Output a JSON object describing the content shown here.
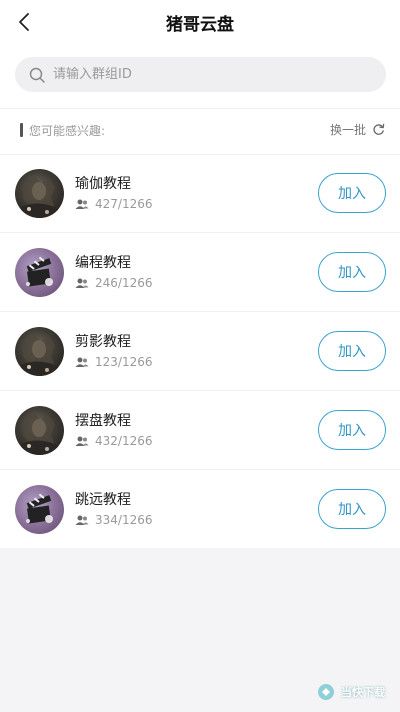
{
  "header": {
    "title": "猪哥云盘"
  },
  "search": {
    "placeholder": "请输入群组ID"
  },
  "section": {
    "title": "您可能感兴趣:",
    "refresh_label": "换一批"
  },
  "groups": [
    {
      "name": "瑜伽教程",
      "members": "427/1266",
      "join_label": "加入",
      "avatar": "dark-figure"
    },
    {
      "name": "编程教程",
      "members": "246/1266",
      "join_label": "加入",
      "avatar": "film-clapper"
    },
    {
      "name": "剪影教程",
      "members": "123/1266",
      "join_label": "加入",
      "avatar": "dark-figure"
    },
    {
      "name": "摆盘教程",
      "members": "432/1266",
      "join_label": "加入",
      "avatar": "dark-figure"
    },
    {
      "name": "跳远教程",
      "members": "334/1266",
      "join_label": "加入",
      "avatar": "film-clapper"
    }
  ],
  "watermark": {
    "text": "当快下载"
  },
  "colors": {
    "accent": "#2f96c6",
    "background": "#f4f4f7",
    "search_bg": "#efeff1"
  }
}
